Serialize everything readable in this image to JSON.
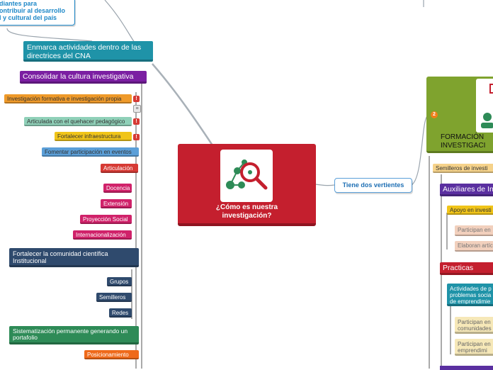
{
  "central": {
    "title": "¿Cómo es nuestra investigación?"
  },
  "top_left_note": {
    "line1": "diantes para",
    "line2": "ontribuir al desarrollo",
    "line3": "l y cultural del país"
  },
  "left": {
    "cna": "Enmarca actividades dentro de las directrices del CNA",
    "consolidar": "Consolidar la cultura investigativa",
    "formativa": "Investigación formativa e investigación propia",
    "articulada": "Articulada con el quehacer pedagógico",
    "infra": "Fortalecer infraestructura",
    "fomentar": "Fomentar participación en eventos",
    "articulacion": "Articulación",
    "docencia": "Docencia",
    "extension": "Extensión",
    "proyeccion": "Proyección Social",
    "internacionalizacion": "Internacionalización",
    "comunidad": "Fortalecer la comunidad científica Institucional",
    "grupos": "Grupos",
    "semilleros": "Semilleros",
    "redes": "Redes",
    "sistematizacion": "Sistematización permanente generando un portafolio",
    "posicionamiento": "Posicionamiento"
  },
  "right": {
    "vertientes": "Tiene dos vertientes",
    "badge": "2",
    "formacion": "FORMACIÓN INVESTIGACI",
    "semilleros": "Semilleros de investi",
    "auxiliares": "Auxiliares de In",
    "apoyo": "Apoyo en investi",
    "participan1": "Participan en",
    "elaboran": "Elaboran artíc",
    "practicas": "Practicas profes",
    "actividades": "Actividades de p problemas socia de emprendimie",
    "participan2": "Participan en comunidades",
    "participan3": "Participan en emprendimi"
  },
  "icons": {
    "central": "network-search-icon",
    "formacion": "person-icon",
    "flag": "warning-flag-icon"
  },
  "colors": {
    "central": "#c41f2e",
    "blue": "#1e88c8",
    "teal": "#1f93a8",
    "purple": "#7b1fa2",
    "orange": "#ef7f1a",
    "yellow": "#f0c419",
    "green_formacion": "#7fa32e",
    "navy": "#2f4a6d",
    "pink": "#d0226a",
    "red": "#d63a34"
  }
}
